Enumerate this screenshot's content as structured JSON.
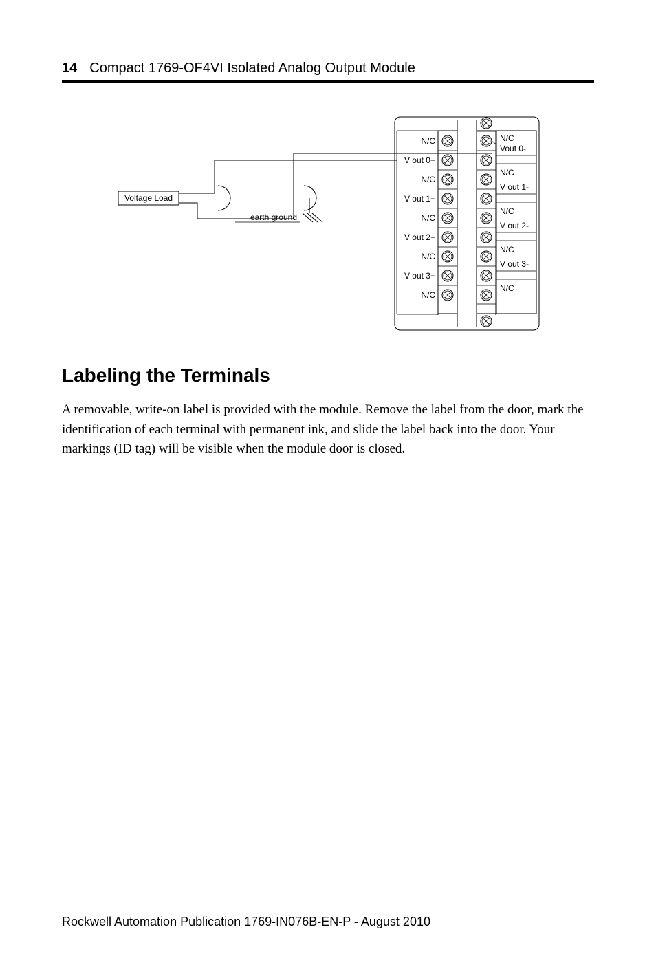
{
  "header": {
    "page_number": "14",
    "document_title": "Compact 1769-OF4VI Isolated Analog Output Module"
  },
  "diagram": {
    "voltage_load": "Voltage Load",
    "earth_ground": "earth ground",
    "left_labels": [
      "N/C",
      "V out 0+",
      "N/C",
      "V out 1+",
      "N/C",
      "V out 2+",
      "N/C",
      "V out 3+",
      "N/C"
    ],
    "right_labels": [
      "N/C",
      "Vout 0-",
      "N/C",
      "V out 1-",
      "N/C",
      "V out 2-",
      "N/C",
      "V out 3-",
      "N/C"
    ]
  },
  "section": {
    "heading": "Labeling the Terminals",
    "paragraph": "A removable, write-on label is provided with the module. Remove the label from the door, mark the identification of each terminal with permanent ink, and slide the label back into the door. Your markings (ID tag) will be visible when the module door is closed."
  },
  "footer": "Rockwell Automation Publication  1769-IN076B-EN-P - August 2010"
}
